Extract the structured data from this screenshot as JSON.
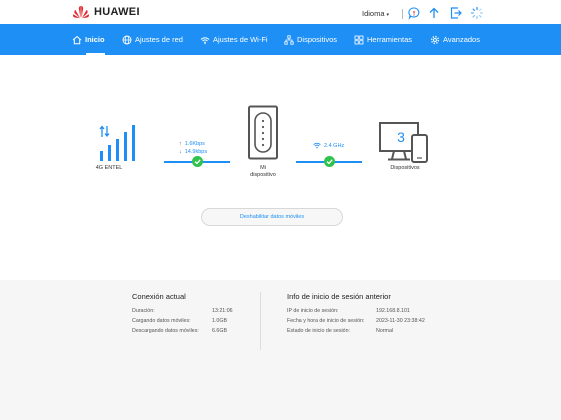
{
  "header": {
    "brand": "HUAWEI",
    "language_label": "Idioma",
    "language_caret": "▾",
    "icons": [
      "sms-icon",
      "upload-icon",
      "logout-icon",
      "loading-icon"
    ]
  },
  "nav": {
    "items": [
      {
        "label": "Inicio",
        "icon": "home-icon"
      },
      {
        "label": "Ajustes de red",
        "icon": "globe-icon"
      },
      {
        "label": "Ajustes de Wi-Fi",
        "icon": "wifi-icon"
      },
      {
        "label": "Dispositivos",
        "icon": "network-icon"
      },
      {
        "label": "Herramientas",
        "icon": "tools-icon"
      },
      {
        "label": "Avanzados",
        "icon": "gear-icon"
      }
    ],
    "active_index": 0
  },
  "diagram": {
    "network_label": "4G ENTEL",
    "upload_speed": "1.6Kbps",
    "download_speed": "14.9kbps",
    "router_label_line1": "Mi",
    "router_label_line2": "dispositivo",
    "wifi_band": "2.4 GHz",
    "device_count": "3",
    "devices_label": "Dispositivos",
    "accent_color": "#1e8ff5",
    "ok_color": "#2fc24c"
  },
  "actions": {
    "disable_mobile_data": "Deshabilitar datos móviles"
  },
  "current_connection": {
    "title": "Conexión actual",
    "rows": [
      {
        "key": "Duración:",
        "value": "13:21:06"
      },
      {
        "key": "Cargando datos móviles:",
        "value": "1.0GB"
      },
      {
        "key": "Descargando datos móviles:",
        "value": "6.6GB"
      }
    ]
  },
  "previous_login": {
    "title": "Info de inicio de sesión anterior",
    "rows": [
      {
        "key": "IP de inicio de sesión:",
        "value": "192.168.8.101"
      },
      {
        "key": "Fecha y hora de inicio de sesión:",
        "value": "2023-11-30 23:38:42"
      },
      {
        "key": "Estado de inicio de sesión:",
        "value": "Normal"
      }
    ]
  }
}
